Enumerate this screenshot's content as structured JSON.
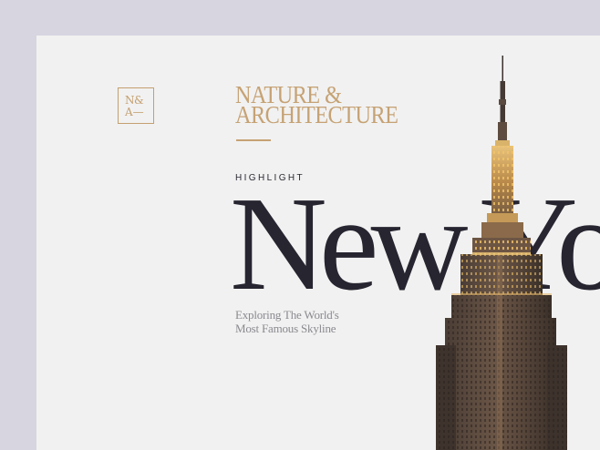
{
  "logo": {
    "line1": "N&",
    "line2": "A—"
  },
  "title": {
    "line1": "NATURE &",
    "line2": "ARCHITECTURE"
  },
  "eyebrow": "HIGHLIGHT",
  "headline": "New York",
  "subtitle": {
    "line1": "Exploring The World's",
    "line2": "Most Famous Skyline"
  },
  "colors": {
    "outer_background": "#d6d5e0",
    "page_background": "#f1f1f1",
    "accent_gold": "#c6a274",
    "headline_dark": "#262530",
    "subtitle_gray": "#8a8a90"
  },
  "image": {
    "subject": "empire-state-building-photo"
  }
}
